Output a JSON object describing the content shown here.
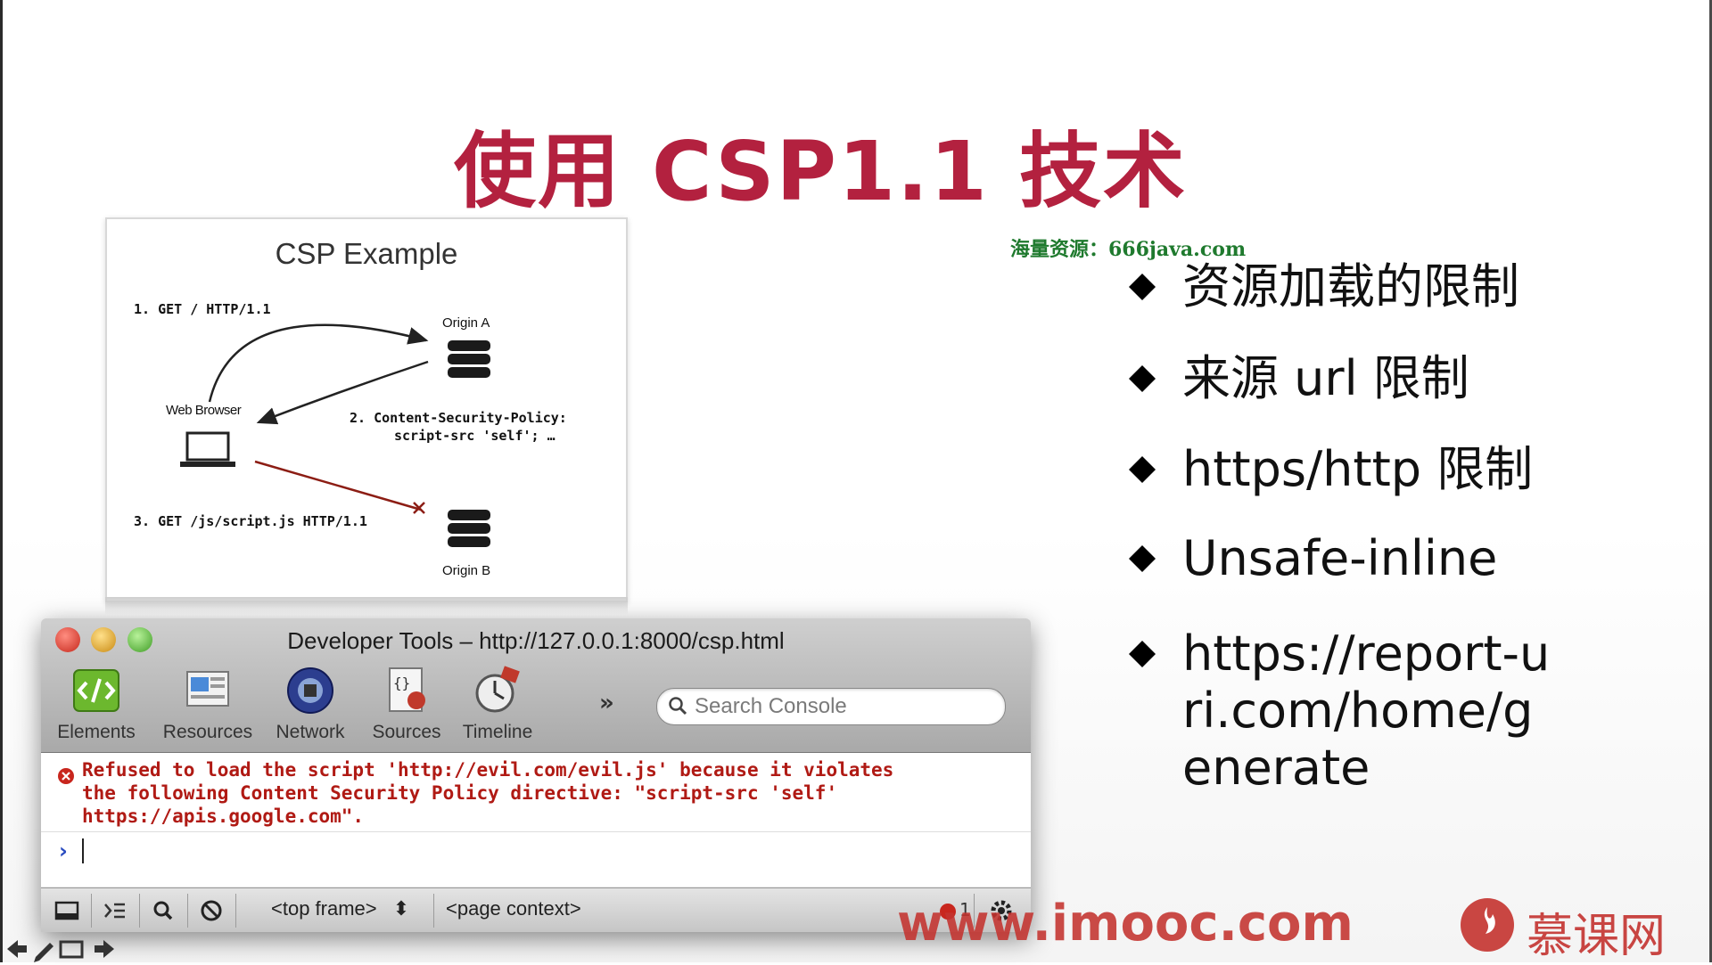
{
  "slide": {
    "title": "使用 CSP1.1 技术",
    "watermark": "海量资源：666java.com",
    "bullets": [
      "资源加载的限制",
      "来源 url 限制",
      "https/http 限制",
      "Unsafe-inline",
      "https://report-uri.com/home/generate"
    ],
    "bullet_icon": "diamond-icon"
  },
  "csp_example": {
    "title": "CSP Example",
    "step1": "1. GET / HTTP/1.1",
    "origin_a": "Origin A",
    "web_browser": "Web Browser",
    "step2_line1": "2. Content-Security-Policy:",
    "step2_line2": "script-src 'self'; …",
    "step3": "3. GET /js/script.js HTTP/1.1",
    "origin_b": "Origin B"
  },
  "devtools": {
    "title": "Developer Tools – http://127.0.0.1:8000/csp.html",
    "tools": [
      {
        "label": "Elements",
        "icon": "elements-icon"
      },
      {
        "label": "Resources",
        "icon": "resources-icon"
      },
      {
        "label": "Network",
        "icon": "network-icon"
      },
      {
        "label": "Sources",
        "icon": "sources-icon"
      },
      {
        "label": "Timeline",
        "icon": "timeline-icon"
      }
    ],
    "more": "»",
    "search_placeholder": "Search Console",
    "error_message": "Refused to load the script 'http://evil.com/evil.js' because it violates\nthe following Content Security Policy directive: \"script-src 'self'\nhttps://apis.google.com\".",
    "prompt": "›",
    "frame_select": "<top frame>",
    "context_select": "<page context>",
    "error_count": "1",
    "colors": {
      "error": "#b01a14"
    }
  },
  "branding": {
    "site": "www.imooc.com",
    "name_cn": "慕课网",
    "accent": "#c4332f"
  }
}
